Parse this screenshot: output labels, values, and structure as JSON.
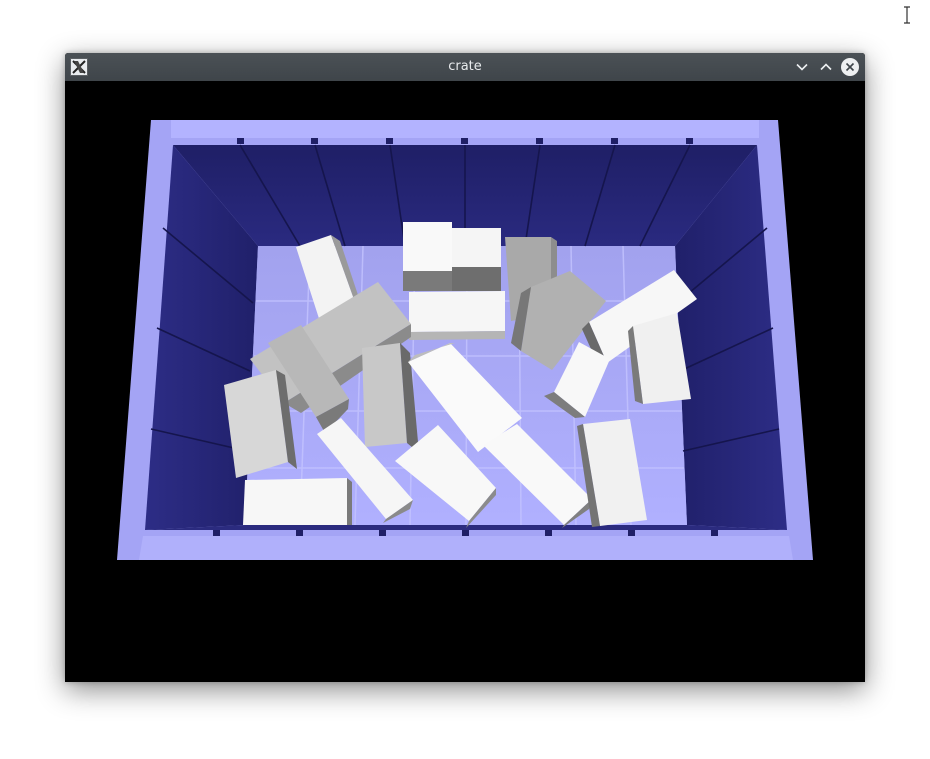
{
  "window": {
    "title": "crate",
    "icons": {
      "app": "x11-app-icon",
      "minimize": "chevron-down-icon",
      "maximize": "chevron-up-icon",
      "close": "close-icon"
    }
  },
  "colors": {
    "titlebar": "#43494e",
    "viewport_bg": "#000000",
    "crate_rim": "#a3a3f4",
    "crate_wall_dark": "#23236e",
    "crate_floor": "#a7a7f8",
    "block_light": "#f7f7f7",
    "block_mid": "#c9c9c9",
    "block_dark": "#6f6f6f"
  },
  "desktop": {
    "cursor": "text-cursor-icon"
  }
}
